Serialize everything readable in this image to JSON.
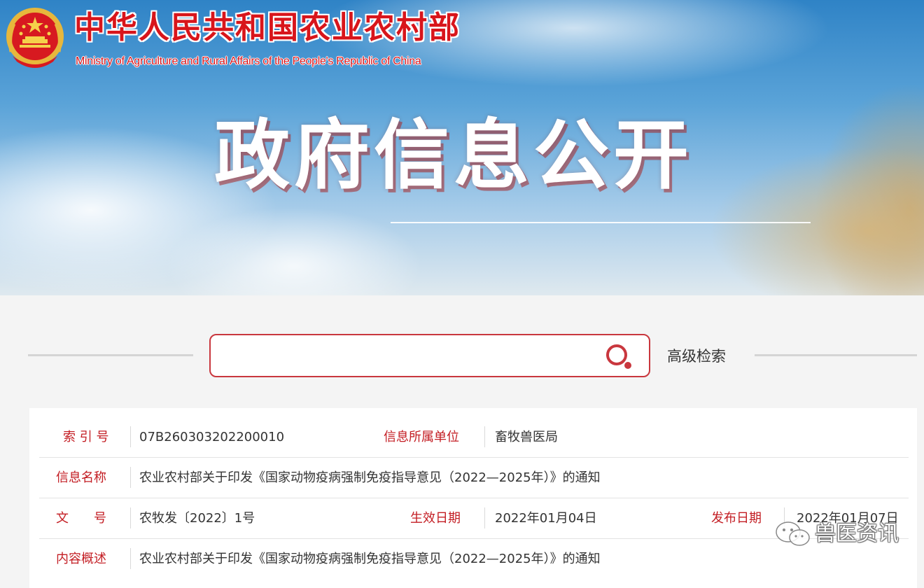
{
  "header": {
    "ministry_name_cn": "中华人民共和国农业农村部",
    "ministry_name_en": "Ministry of Agriculture and Rural Affairs of the People's Republic of China",
    "page_title": "政府信息公开"
  },
  "search": {
    "placeholder": "",
    "value": "",
    "advanced_label": "高级检索"
  },
  "info": {
    "index_label": "索 引 号",
    "index_value": "07B260303202200010",
    "unit_label": "信息所属单位",
    "unit_value": "畜牧兽医局",
    "name_label": "信息名称",
    "name_value": "农业农村部关于印发《国家动物疫病强制免疫指导意见（2022—2025年）》的通知",
    "doc_no_label": "文　　号",
    "doc_no_value": "农牧发〔2022〕1号",
    "effective_label": "生效日期",
    "effective_value": "2022年01月04日",
    "publish_label": "发布日期",
    "publish_value": "2022年01月07日",
    "summary_label": "内容概述",
    "summary_value": "农业农村部关于印发《国家动物疫病强制免疫指导意见（2022—2025年）》的通知"
  },
  "watermark": {
    "text": "兽医资讯"
  },
  "colors": {
    "brand_red": "#d8151b",
    "label_red": "#c31d23",
    "search_border": "#c9373e"
  },
  "icons": {
    "emblem": "national-emblem-icon",
    "search": "search-icon",
    "watermark": "wechat-icon"
  }
}
